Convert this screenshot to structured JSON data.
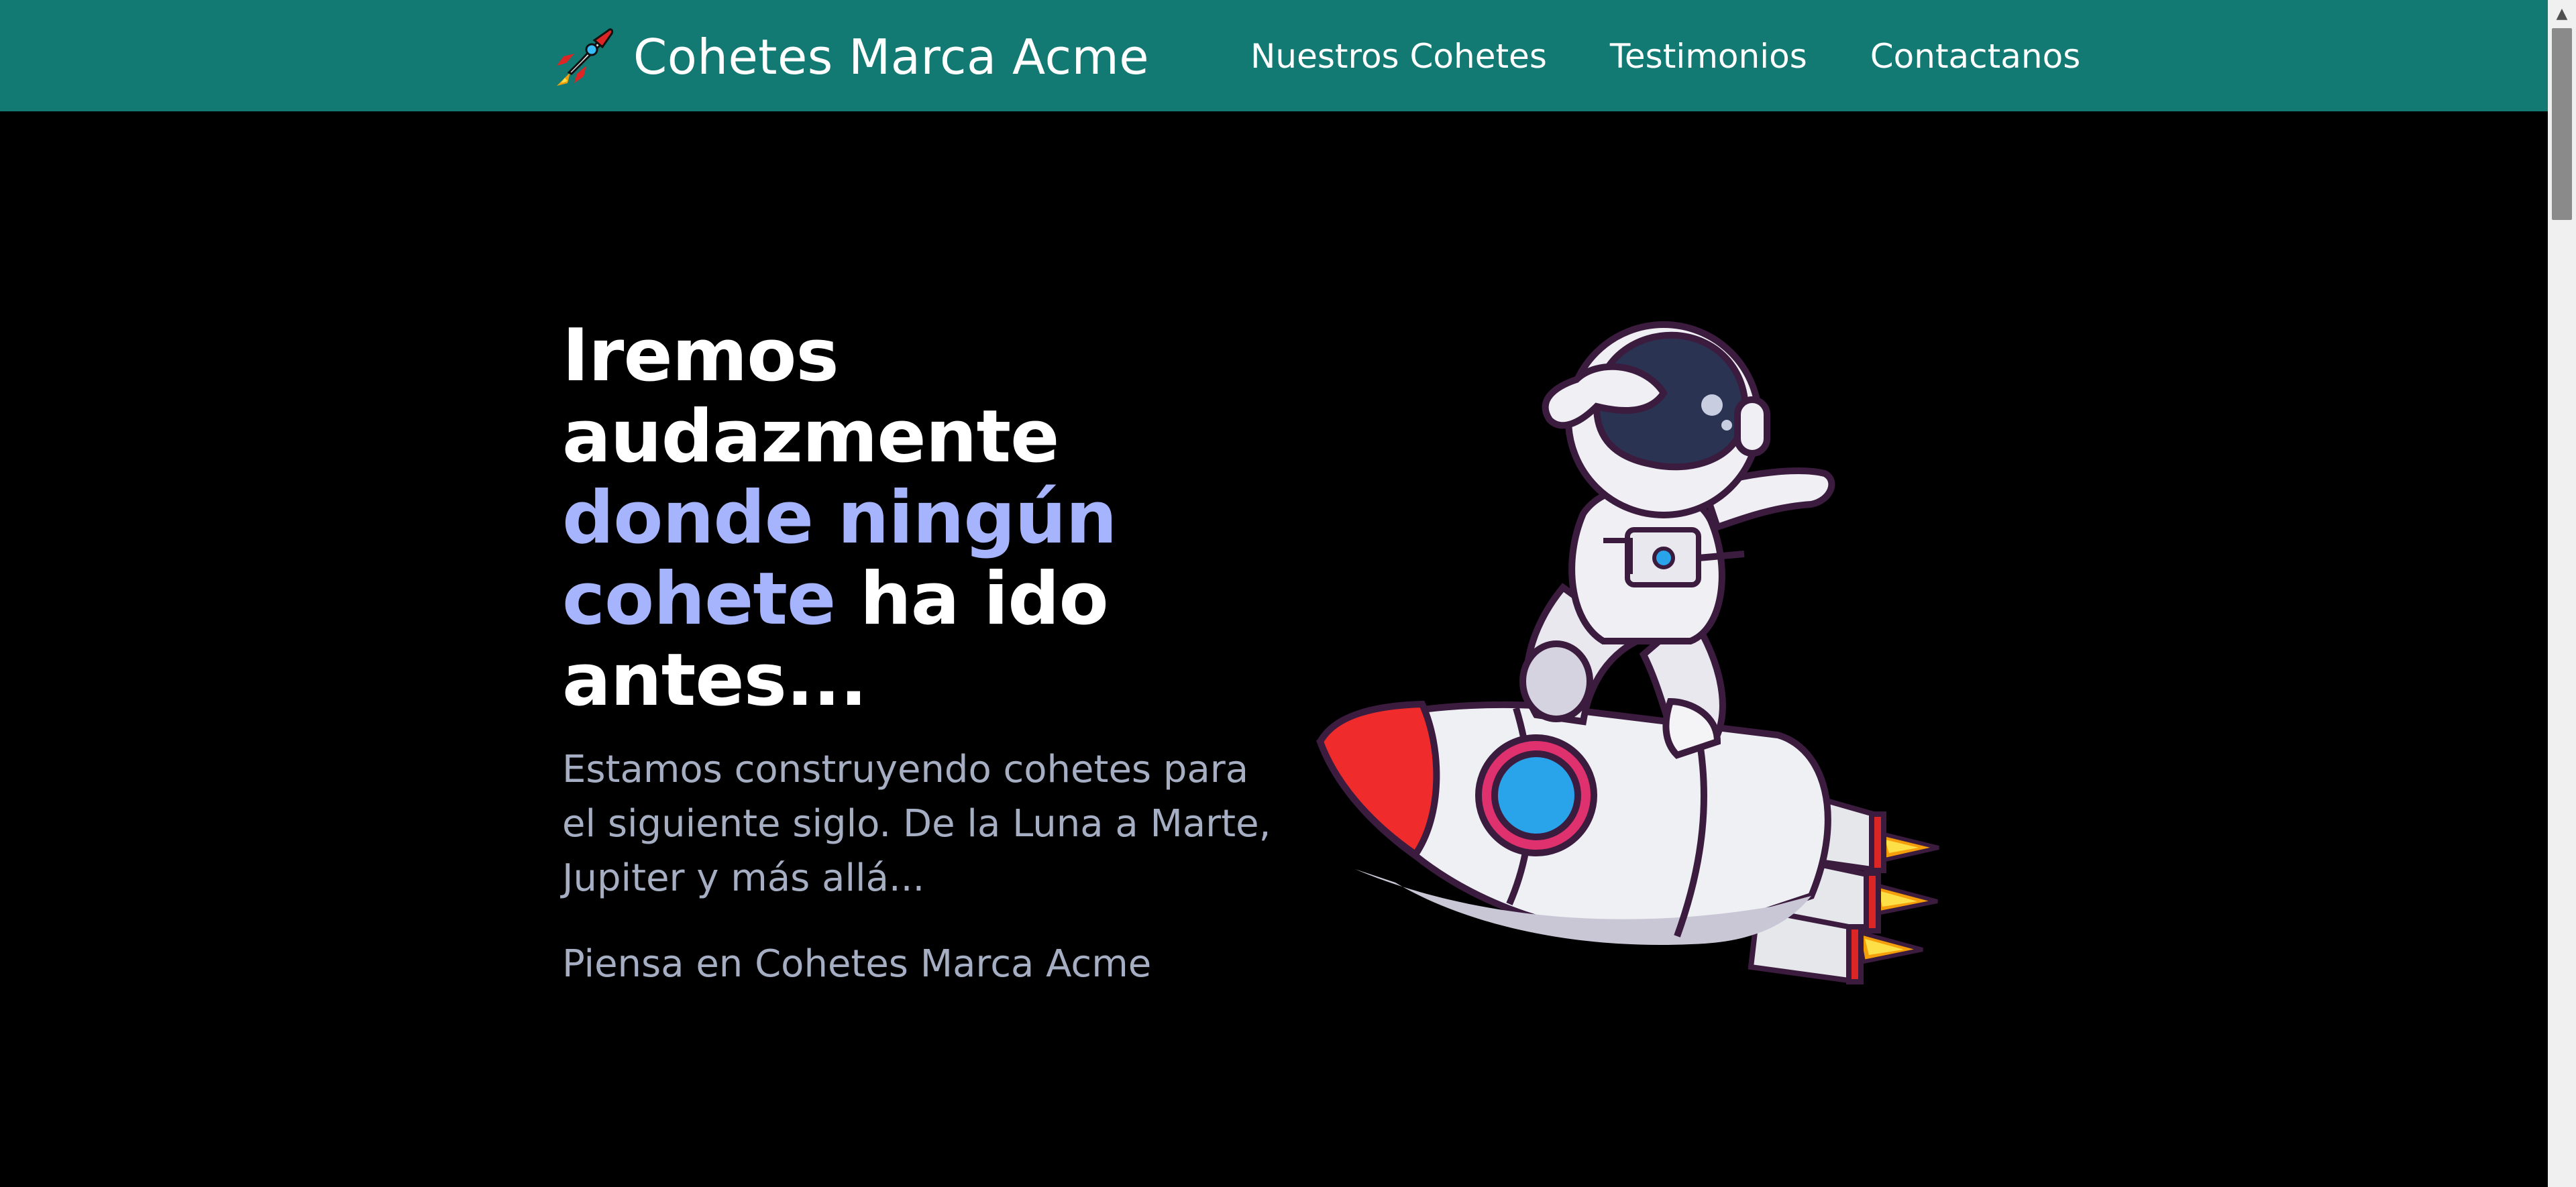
{
  "header": {
    "brand_title": "Cohetes Marca Acme",
    "brand_icon": "rocket-icon",
    "nav": [
      {
        "label": "Nuestros Cohetes"
      },
      {
        "label": "Testimonios"
      },
      {
        "label": "Contactanos"
      }
    ]
  },
  "hero": {
    "headline_part1": "Iremos audazmente",
    "headline_accent": "donde ningún cohete",
    "headline_part2": "ha ido antes...",
    "lead": "Estamos construyendo cohetes para el siguiente siglo. De la Luna a Marte, Jupiter y más allá...",
    "tagline": "Piensa en Cohetes Marca Acme",
    "illustration": "astronaut-on-rocket-illustration"
  },
  "colors": {
    "header_bg": "#127a72",
    "page_bg": "#000000",
    "headline": "#ffffff",
    "accent": "#a5b4fc",
    "body_text": "#a5aec2"
  }
}
